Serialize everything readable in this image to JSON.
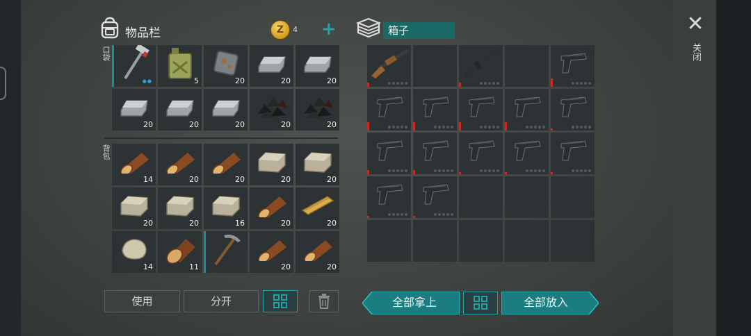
{
  "inventory": {
    "title": "物品栏",
    "pocket_label": "口袋",
    "backpack_label": "背包",
    "coins": "4",
    "pockets": [
      {
        "icon": "hammer",
        "qty": "",
        "dots": "●●",
        "sel": true
      },
      {
        "icon": "jerrycan",
        "qty": "5"
      },
      {
        "icon": "scrap-metal",
        "qty": "20"
      },
      {
        "icon": "iron-ingot",
        "qty": "20"
      },
      {
        "icon": "iron-ingot",
        "qty": "20"
      },
      {
        "icon": "iron-ingot",
        "qty": "20"
      },
      {
        "icon": "iron-ingot",
        "qty": "20"
      },
      {
        "icon": "iron-ingot",
        "qty": "20"
      },
      {
        "icon": "coal",
        "qty": "20"
      },
      {
        "icon": "coal",
        "qty": "20"
      }
    ],
    "backpack": [
      {
        "icon": "log",
        "qty": "14"
      },
      {
        "icon": "log",
        "qty": "20"
      },
      {
        "icon": "log",
        "qty": "20"
      },
      {
        "icon": "stone-block",
        "qty": "20"
      },
      {
        "icon": "stone-block",
        "qty": "20"
      },
      {
        "icon": "stone-block",
        "qty": "20"
      },
      {
        "icon": "stone-block",
        "qty": "20"
      },
      {
        "icon": "stone-block",
        "qty": "16"
      },
      {
        "icon": "log",
        "qty": "20"
      },
      {
        "icon": "plank",
        "qty": "20"
      },
      {
        "icon": "stone",
        "qty": "14"
      },
      {
        "icon": "log-big",
        "qty": "11"
      },
      {
        "icon": "pickaxe",
        "qty": "",
        "sel": true
      },
      {
        "icon": "log",
        "qty": "20"
      },
      {
        "icon": "log",
        "qty": "20"
      }
    ],
    "use_button": "使用",
    "split_button": "分开"
  },
  "container": {
    "name": "箱子",
    "slots": [
      {
        "icon": "shotgun",
        "cond": 0.1
      },
      {
        "icon": ""
      },
      {
        "icon": "rifle",
        "cond": 0.1
      },
      {
        "icon": ""
      },
      {
        "icon": "pistol",
        "cond": 0.2
      },
      {
        "icon": "pistol",
        "cond": 0.2
      },
      {
        "icon": "pistol",
        "cond": 0.2
      },
      {
        "icon": "pistol",
        "cond": 0.2
      },
      {
        "icon": "pistol",
        "cond": 0.2
      },
      {
        "icon": "pistol",
        "cond": 0.05
      },
      {
        "icon": "pistol",
        "cond": 0.1
      },
      {
        "icon": "pistol",
        "cond": 0.1
      },
      {
        "icon": "pistol",
        "cond": 0.05
      },
      {
        "icon": "pistol",
        "cond": 0.05
      },
      {
        "icon": "pistol",
        "cond": 0.05
      },
      {
        "icon": "pistol",
        "cond": 0.05
      },
      {
        "icon": "pistol",
        "cond": 0.05
      },
      {
        "icon": ""
      },
      {
        "icon": ""
      },
      {
        "icon": ""
      },
      {
        "icon": ""
      },
      {
        "icon": ""
      },
      {
        "icon": ""
      },
      {
        "icon": ""
      },
      {
        "icon": ""
      }
    ],
    "take_all": "全部拿上",
    "put_all": "全部放入"
  },
  "close_label": "关闭",
  "colors": {
    "accent": "#1fa3a6",
    "condition": "#c92a22",
    "label_bg": "#1a6967"
  }
}
